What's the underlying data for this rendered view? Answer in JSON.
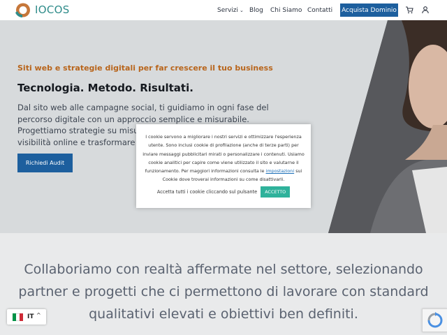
{
  "header": {
    "logo_text": "IOCOS",
    "nav": [
      {
        "label": "Servizi"
      },
      {
        "label": "Blog"
      },
      {
        "label": "Chi Siamo"
      },
      {
        "label": "Contatti"
      }
    ],
    "cta_label": "Acquista Dominio",
    "cart_icon": "cart-icon",
    "user_icon": "user-icon"
  },
  "hero": {
    "subtitle": "Siti web e strategie digitali per far crescere il tuo business",
    "headline": "Tecnologia. Metodo. Risultati.",
    "text": "Dal sito web alle campagne social, ti guidiamo in ogni fase del percorso digitale con un approccio semplice e misurabile. Progettiamo strategie su misura per aumentare la tua visibilità online e trasformare",
    "button_label": "Richiedi Audit"
  },
  "collab_text": "Collaboriamo con realtà affermate nel settore, selezionando partner e progetti che ci permettono di lavorare con standard qualitativi elevati e obiettivi ben definiti.",
  "cookie": {
    "text_before_link": "I cookie servono a migliorare i nostri servizi e ottimizzare l'esperienza utente. Sono inclusi cookie di profilazione (anche di terze parti) per inviare messaggi pubblicitari mirati o personalizzare i contenuti. Usiamo cookie analitici per capire come viene utilizzato il sito e valutarne il funzionamento. Per maggiori informazioni consulta le",
    "link_text": "impostazioni",
    "text_after_link": "sui Cookie dove troverai informazioni su come disattivarli.",
    "accept_text": "Accetta tutti i cookie cliccando sul pulsante",
    "accept_button": "ACCETTO"
  },
  "language": {
    "code": "IT",
    "flag_colors": [
      "#009246",
      "#ffffff",
      "#ce2b37"
    ]
  },
  "colors": {
    "brand": "#2f8c8a",
    "primary_button": "#1d5f9e",
    "accent_orange": "#b8651c",
    "accept_green": "#2fb29b"
  }
}
